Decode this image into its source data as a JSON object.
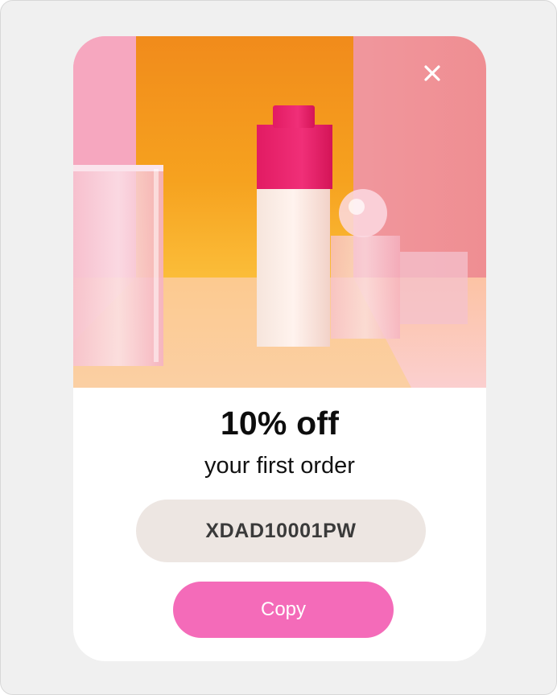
{
  "popup": {
    "headline": "10% off",
    "subline": "your first order",
    "code": "XDAD10001PW",
    "copy_label": "Copy",
    "close_icon": "close-icon",
    "image": "product-bottle-photo"
  },
  "colors": {
    "backdrop": "#f0f0f0",
    "card": "#ffffff",
    "code_background": "#ede6e2",
    "copy_button": "#f46bb9",
    "headline_text": "#0d0d0d"
  }
}
